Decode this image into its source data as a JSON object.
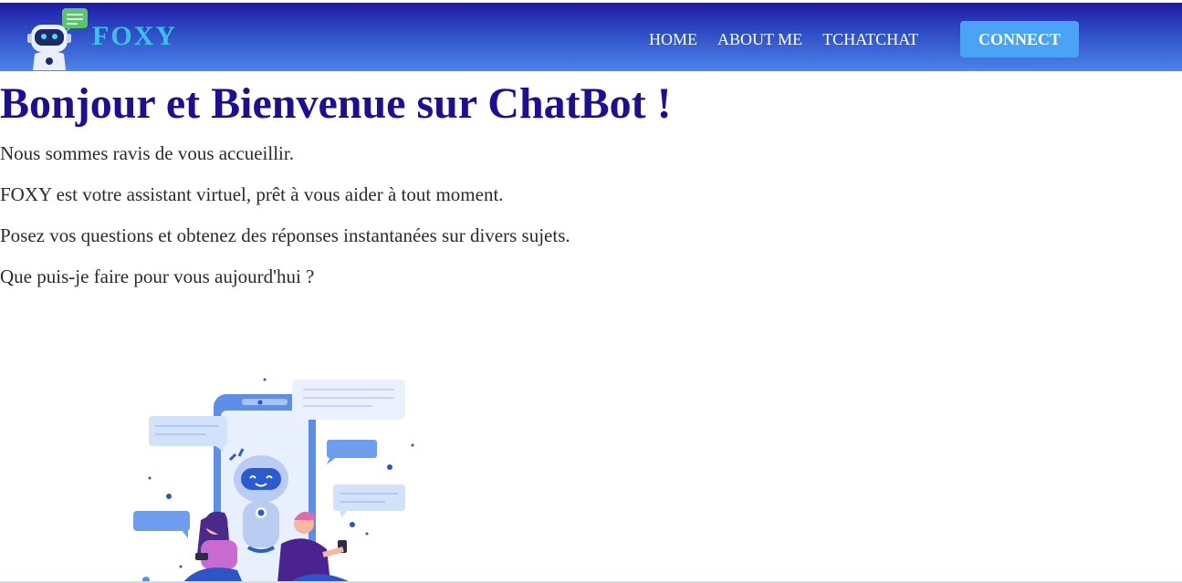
{
  "brand": {
    "name": "FOXY",
    "logo_icon": "robot-chat-icon"
  },
  "nav": {
    "items": [
      {
        "label": "HOME"
      },
      {
        "label": "ABOUT ME"
      },
      {
        "label": "TCHATCHAT"
      }
    ],
    "connect_label": "CONNECT"
  },
  "main": {
    "title": "Bonjour et Bienvenue sur ChatBot !",
    "paragraphs": [
      "Nous sommes ravis de vous accueillir.",
      "FOXY est votre assistant virtuel, prêt à vous aider à tout moment.",
      "Posez vos questions et obtenez des réponses instantanées sur divers sujets.",
      "Que puis-je faire pour vous aujourd'hui ?"
    ],
    "illustration": "chatbot-people-illustration"
  },
  "colors": {
    "nav_gradient_top": "#1f1aa6",
    "nav_gradient_bottom": "#4c84ec",
    "brand_text": "#3ebfe8",
    "title": "#1c0f93",
    "connect_button": "#4aa3f4"
  }
}
